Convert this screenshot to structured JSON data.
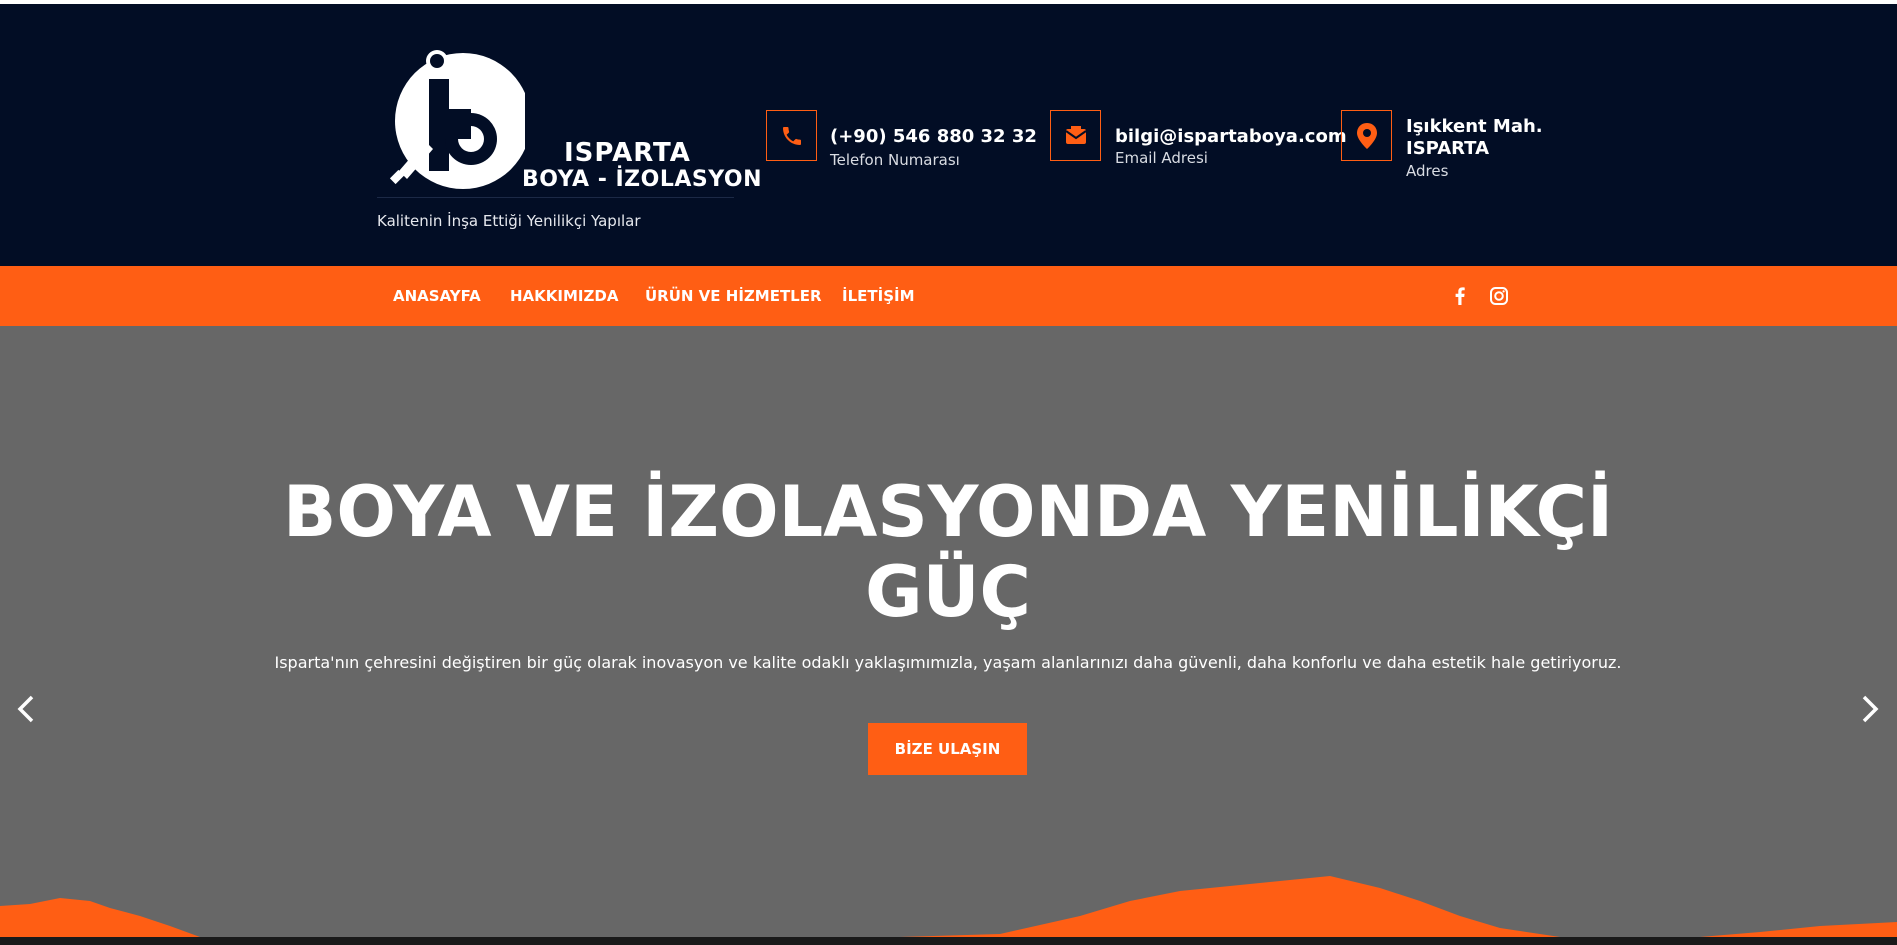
{
  "brand": {
    "name": "ISPARTA",
    "subtitle": "BOYA - İZOLASYON",
    "tagline": "Kalitenin İnşa Ettiği Yenilikçi Yapılar"
  },
  "contacts": {
    "phone": {
      "value": "(+90) 546 880 32 32",
      "label": "Telefon Numarası",
      "icon": "phone-icon"
    },
    "email": {
      "value": "bilgi@ispartaboya.com",
      "label": "Email Adresi",
      "icon": "mail-icon"
    },
    "address": {
      "line1": "Işıkkent Mah.",
      "line2": "ISPARTA",
      "label": "Adres",
      "icon": "location-pin-icon"
    }
  },
  "nav": {
    "items": [
      "ANASAYFA",
      "HAKKIMIZDA",
      "ÜRÜN VE HİZMETLER",
      "İLETİŞİM"
    ],
    "social": [
      "facebook-icon",
      "instagram-icon"
    ]
  },
  "hero": {
    "title_line1": "BOYA VE İZOLASYONDA YENİLİKÇİ",
    "title_line2": "GÜÇ",
    "text": "Isparta'nın çehresini değiştiren bir güç olarak inovasyon ve kalite odaklı yaklaşımımızla, yaşam alanlarınızı daha güvenli, daha konforlu ve daha estetik hale getiriyoruz.",
    "cta_label": "BİZE ULAŞIN"
  },
  "colors": {
    "accent": "#ff5e14",
    "header_bg": "#020d25",
    "hero_bg": "#676767"
  }
}
